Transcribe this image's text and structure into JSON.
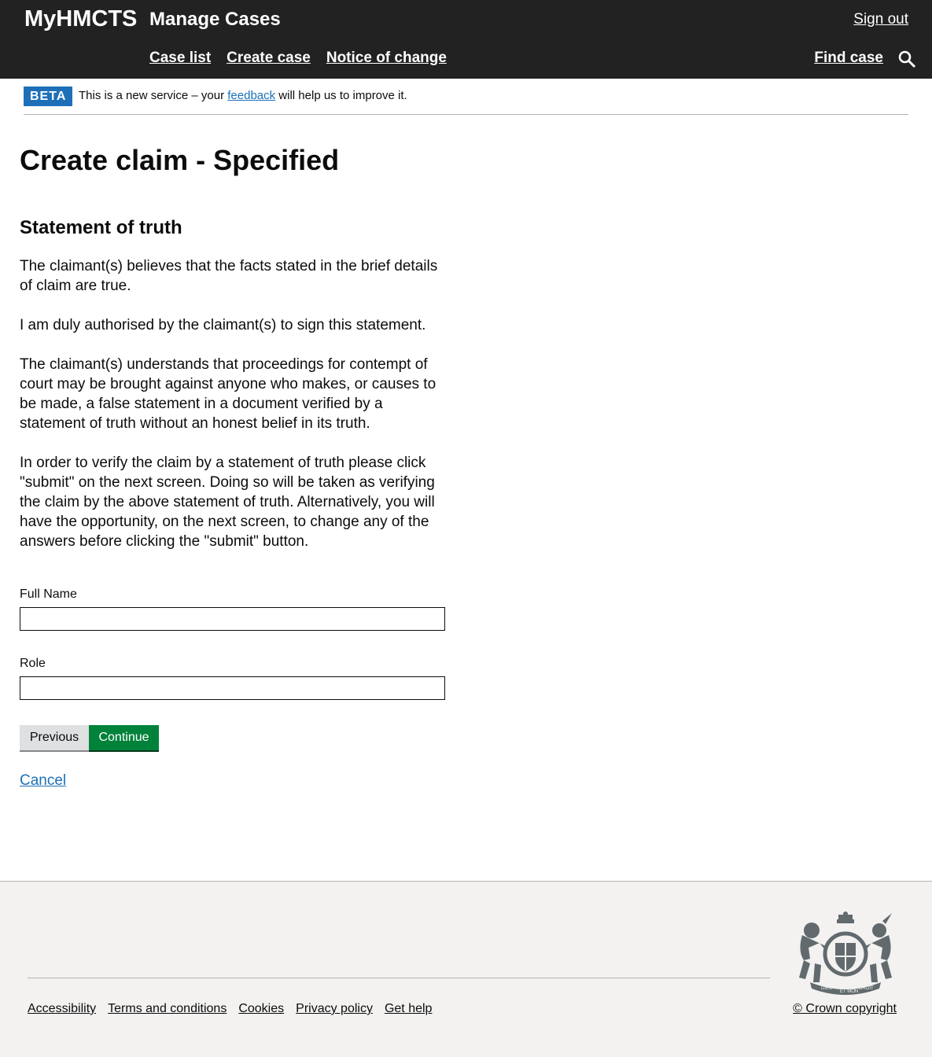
{
  "header": {
    "brand": "MyHMCTS",
    "service": "Manage Cases",
    "sign_out": "Sign out",
    "nav": [
      "Case list",
      "Create case",
      "Notice of change"
    ],
    "find_case": "Find case"
  },
  "beta": {
    "tag": "BETA",
    "text_before": "This is a new service – your ",
    "link": "feedback",
    "text_after": " will help us to improve it."
  },
  "main": {
    "title": "Create claim - Specified",
    "section_title": "Statement of truth",
    "paragraphs": [
      "The claimant(s) believes that the facts stated in the brief details of claim are true.",
      "I am duly authorised by the claimant(s) to sign this statement.",
      "The claimant(s) understands that proceedings for contempt of court may be brought against anyone who makes, or causes to be made, a false statement in a document verified by a statement of truth without an honest belief in its truth.",
      "In order to verify the claim by a statement of truth please click \"submit\" on the next screen. Doing so will be taken as verifying the claim by the above statement of truth. Alternatively, you will have the opportunity, on the next screen, to change any of the answers before clicking the \"submit\" button."
    ],
    "full_name_label": "Full Name",
    "full_name_value": "",
    "role_label": "Role",
    "role_value": "",
    "previous_label": "Previous",
    "continue_label": "Continue",
    "cancel_label": "Cancel"
  },
  "footer": {
    "links": [
      "Accessibility",
      "Terms and conditions",
      "Cookies",
      "Privacy policy",
      "Get help"
    ],
    "copyright": "© Crown copyright",
    "crest_motto": [
      "DIEU",
      "ET MON",
      "DROIT"
    ]
  },
  "colors": {
    "header_bg": "#222222",
    "link": "#1d70b8",
    "beta_tag": "#1d70b8",
    "continue_button": "#00823b",
    "previous_button": "#dee0e2",
    "footer_bg": "#f3f2f1"
  }
}
